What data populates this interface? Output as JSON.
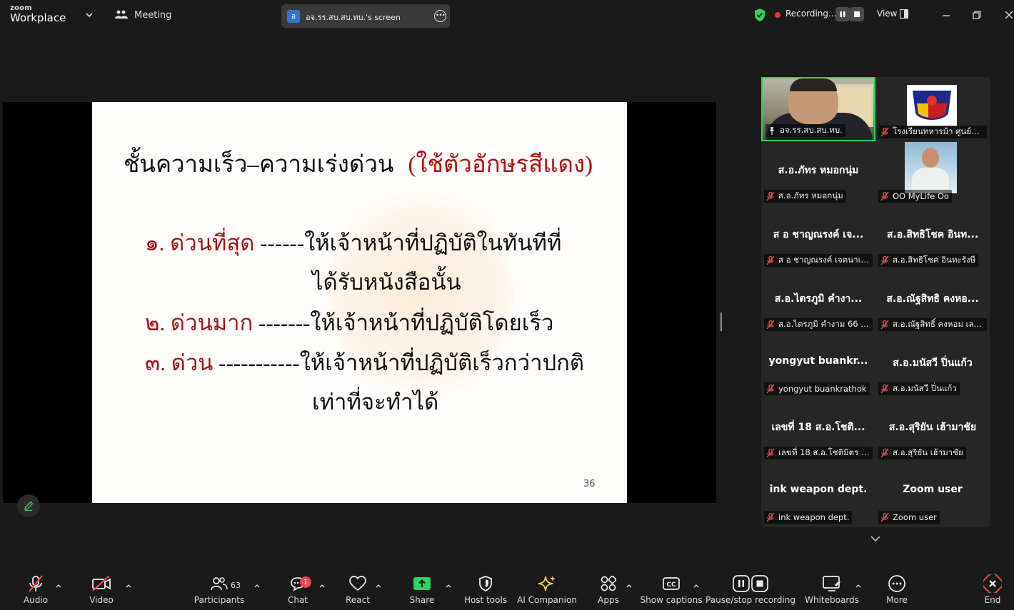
{
  "app": {
    "brand_small": "zoom",
    "brand_large": "Workplace",
    "meeting_label": "Meeting"
  },
  "screen_share": {
    "badge": "อ",
    "label": "อจ.รร.สบ.สบ.ทบ.'s screen"
  },
  "recording": {
    "label": "Recording...",
    "color": "#e03a3a"
  },
  "view": {
    "label": "View"
  },
  "slide": {
    "title": "ชั้นความเร็ว–ความเร่งด่วน",
    "title_note": "(ใช้ตัวอักษรสีแดง)",
    "items": [
      {
        "num": "๑. ด่วนที่สุด",
        "text": "  ------ให้เจ้าหน้าที่ปฏิบัติในทันทีที่"
      },
      {
        "num": "",
        "text": "ได้รับหนังสือนั้น"
      },
      {
        "num": "๒. ด่วนมาก",
        "text": " -------ให้เจ้าหน้าที่ปฏิบัติโดยเร็ว"
      },
      {
        "num": "๓. ด่วน",
        "text": "  -----------ให้เจ้าหน้าที่ปฏิบัติเร็วกว่าปกติ"
      },
      {
        "num": "",
        "text": "เท่าที่จะทำได้"
      }
    ],
    "page_number": "36",
    "accent_color": "#b01010"
  },
  "participants": [
    {
      "name": "",
      "caption": "อจ.รร.สบ.สบ.ทบ.",
      "type": "video",
      "pinned": true
    },
    {
      "name": "",
      "caption": "โรงเรียนทหารม้า ศูนย์การ...",
      "type": "logo"
    },
    {
      "name": "ส.อ.ภัทร   หมอกนุ่ม",
      "caption": "ส.อ.ภัทร   หมอกนุ่ม",
      "type": "name"
    },
    {
      "name": "",
      "caption": "OO MyLife Oo",
      "type": "photo"
    },
    {
      "name": "ส อ ชาญณรงค์  เจ...",
      "caption": "ส อ ชาญณรงค์ เจตนาเสน",
      "type": "name"
    },
    {
      "name": "ส.อ.สิทธิโชค อินท...",
      "caption": "ส.อ.สิทธิโชค อินทะรังษี",
      "type": "name"
    },
    {
      "name": "ส.อ.ไตรภูมิ คำงา...",
      "caption": "ส.อ.ไตรภูมิ คำงาม 66 ร้อ...",
      "type": "name"
    },
    {
      "name": "ส.อ.ณัฐสิทธิ คงหอ...",
      "caption": "ส.อ.ณัฐสิทธิ์ คงหอม เลข...",
      "type": "name"
    },
    {
      "name": "yongyut  buankr...",
      "caption": "yongyut buankrathok",
      "type": "name"
    },
    {
      "name": "ส.อ.มนัสวี ปิ่นแก้ว",
      "caption": "ส.อ.มนัสวี ปิ่นแก้ว",
      "type": "name"
    },
    {
      "name": "เลขที่ 18 ส.อ.โชติ...",
      "caption": "เลขที่ 18 ส.อ.โชติมิตร พิ...",
      "type": "name"
    },
    {
      "name": "ส.อ.สุริยัน  เฮ้ามาชัย",
      "caption": "ส.อ.สุริยัน  เฮ้ามาชัย",
      "type": "name"
    },
    {
      "name": "ink weapon dept.",
      "caption": "ink weapon dept.",
      "type": "name"
    },
    {
      "name": "Zoom user",
      "caption": "Zoom user",
      "type": "name"
    }
  ],
  "toolbar": {
    "audio": "Audio",
    "video": "Video",
    "participants": "Participants",
    "participants_count": "63",
    "chat": "Chat",
    "chat_badge": "1",
    "react": "React",
    "share": "Share",
    "host_tools": "Host tools",
    "ai_companion": "AI Companion",
    "apps": "Apps",
    "show_captions": "Show captions",
    "pause_stop_recording": "Pause/stop recording",
    "whiteboards": "Whiteboards",
    "more": "More",
    "end": "End",
    "share_color": "#2fd160",
    "end_color": "#e8474c",
    "muted_color": "#e8474c",
    "ai_color": "#f5d142"
  }
}
